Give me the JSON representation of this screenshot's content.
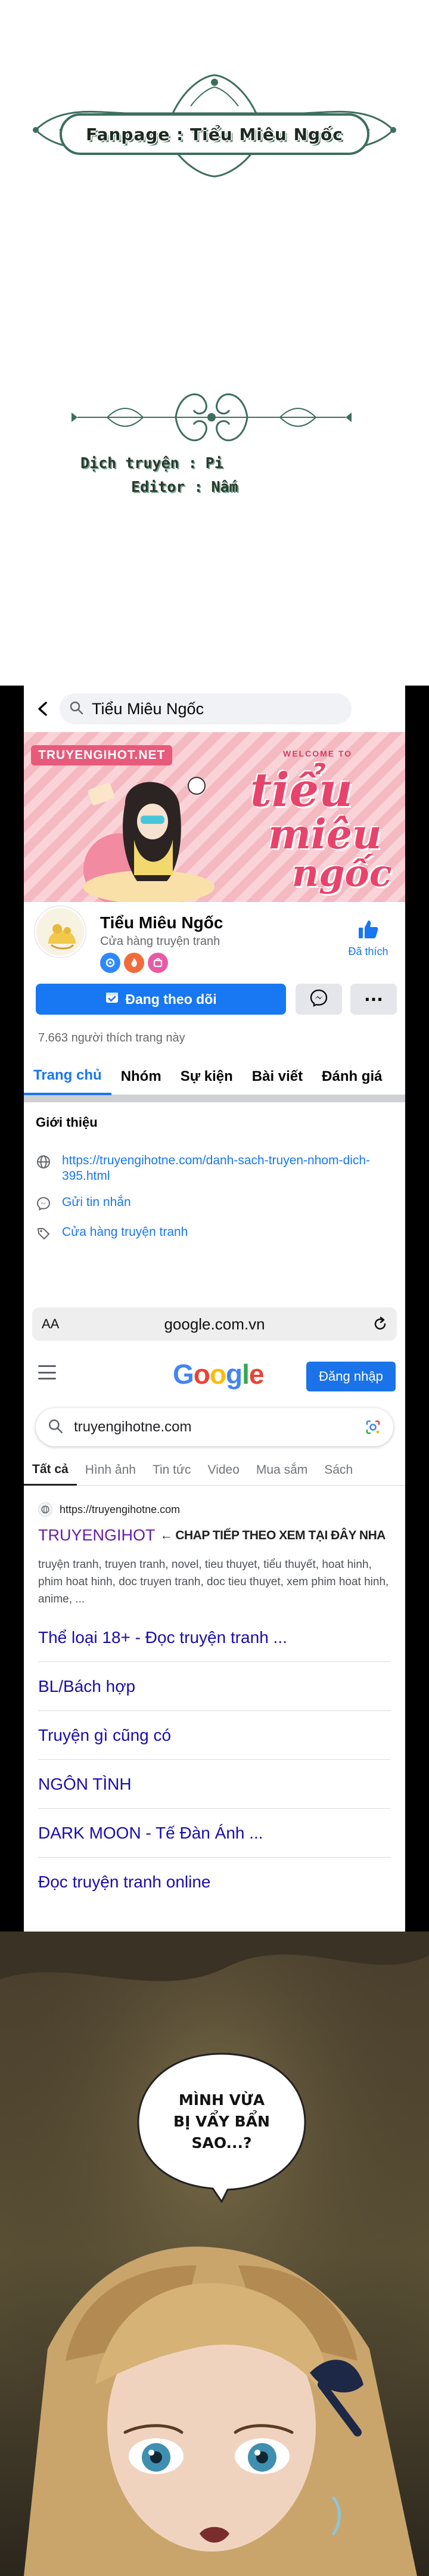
{
  "credits": {
    "fanpage_label": "Fanpage : Tiểu Miêu Ngốc",
    "translator_key": "Dịch truyện :",
    "translator_value": "Pi",
    "editor_key": "Editor :",
    "editor_value": "Nấm"
  },
  "facebook": {
    "search_query": "Tiểu Miêu Ngốc",
    "cover": {
      "brand": "TRUYENGIHOT.NET",
      "welcome": "WELCOME TO",
      "title_line1": "tiểu",
      "title_line2": "miêu",
      "title_line3": "ngốc"
    },
    "page_name": "Tiểu Miêu Ngốc",
    "page_category": "Cửa hàng truyện tranh",
    "liked_label": "Đã thích",
    "follow_label": "Đang theo dõi",
    "more_label": "···",
    "likes_count": "7.663 người thích trang này",
    "tabs": [
      "Trang chủ",
      "Nhóm",
      "Sự kiện",
      "Bài viết",
      "Đánh giá"
    ],
    "intro_title": "Giới thiệu",
    "intro_link": "https://truyengihotne.com/danh-sach-truyen-nhom-dich-395.html",
    "send_message": "Gửi tin nhắn",
    "shop_label": "Cửa hàng truyện tranh",
    "colors": {
      "primary": "#1877f2",
      "cover_pink": "#f7c6cc",
      "title_pink": "#e8436b"
    }
  },
  "safari": {
    "aa_label": "AA",
    "url": "google.com.vn"
  },
  "google": {
    "logo_letters": [
      "G",
      "o",
      "o",
      "g",
      "l",
      "e"
    ],
    "logo_colors": [
      "#4285f4",
      "#ea4335",
      "#fbbc05",
      "#4285f4",
      "#34a853",
      "#ea4335"
    ],
    "signin_label": "Đăng nhập",
    "search_query": "truyengihotne.com",
    "tabs": [
      "Tất cả",
      "Hình ảnh",
      "Tin tức",
      "Video",
      "Mua sắm",
      "Sách"
    ],
    "result": {
      "site_url": "https://truyengihotne.com",
      "title": "TRUYENGIHOT",
      "title_extra": "← CHAP TIẾP THEO XEM TẠI ĐÂY NHA",
      "snippet": "truyện tranh, truyen tranh, novel, tieu thuyet, tiểu thuyết, hoat hinh, phim hoat hinh, doc truyen tranh, doc tieu thuyet, xem phim hoat hinh, anime, ..."
    },
    "sitelinks": [
      "Thể loại 18+ - Đọc truyện tranh ...",
      "BL/Bách hợp",
      "Truyện gì cũng có",
      "NGÔN TÌNH",
      "DARK MOON - Tế Đàn Ánh ...",
      "Đọc truyện tranh online"
    ]
  },
  "manga": {
    "speech_line1": "MÌNH VỪA",
    "speech_line2": "BỊ VẨY BẨN",
    "speech_line3": "SAO...?"
  }
}
